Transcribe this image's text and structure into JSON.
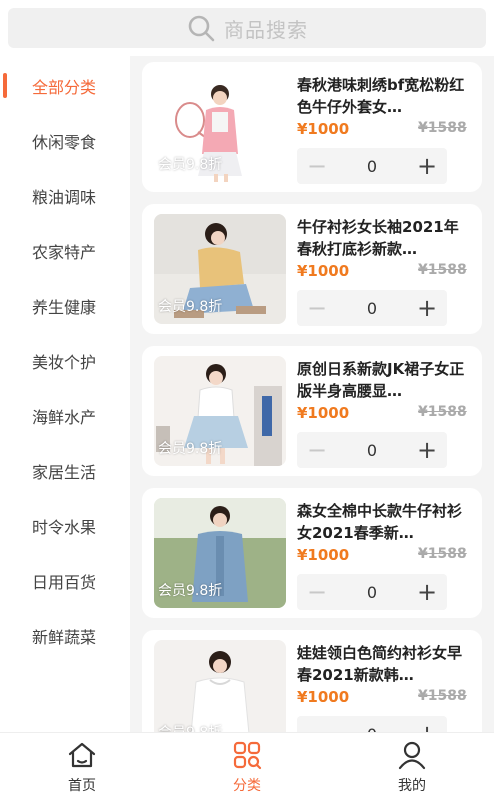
{
  "search": {
    "placeholder": "商品搜索"
  },
  "categories": [
    {
      "label": "全部分类",
      "active": true
    },
    {
      "label": "休闲零食",
      "active": false
    },
    {
      "label": "粮油调味",
      "active": false
    },
    {
      "label": "农家特产",
      "active": false
    },
    {
      "label": "养生健康",
      "active": false
    },
    {
      "label": "美妆个护",
      "active": false
    },
    {
      "label": "海鲜水产",
      "active": false
    },
    {
      "label": "家居生活",
      "active": false
    },
    {
      "label": "时令水果",
      "active": false
    },
    {
      "label": "日用百货",
      "active": false
    },
    {
      "label": "新鲜蔬菜",
      "active": false
    }
  ],
  "products": [
    {
      "title": "春秋港味刺绣bf宽松粉红色牛仔外套女…",
      "price": "¥1000",
      "original_price": "¥1588",
      "member_tag": "会员9.8折",
      "quantity": "0",
      "minus": "−",
      "plus": "+"
    },
    {
      "title": "牛仔衬衫女长袖2021年春秋打底衫新款…",
      "price": "¥1000",
      "original_price": "¥1588",
      "member_tag": "会员9.8折",
      "quantity": "0",
      "minus": "−",
      "plus": "+"
    },
    {
      "title": "原创日系新款JK裙子女正版半身高腰显…",
      "price": "¥1000",
      "original_price": "¥1588",
      "member_tag": "会员9.8折",
      "quantity": "0",
      "minus": "−",
      "plus": "+"
    },
    {
      "title": "森女全棉中长款牛仔衬衫女2021春季新…",
      "price": "¥1000",
      "original_price": "¥1588",
      "member_tag": "会员9.8折",
      "quantity": "0",
      "minus": "−",
      "plus": "+"
    },
    {
      "title": "娃娃领白色简约衬衫女早春2021新款韩…",
      "price": "¥1000",
      "original_price": "¥1588",
      "member_tag": "会员9.8折",
      "quantity": "0",
      "minus": "−",
      "plus": "+"
    }
  ],
  "tabbar": {
    "home": "首页",
    "category": "分类",
    "mine": "我的"
  },
  "colors": {
    "accent": "#f56a3a",
    "price": "#f07a1f"
  }
}
